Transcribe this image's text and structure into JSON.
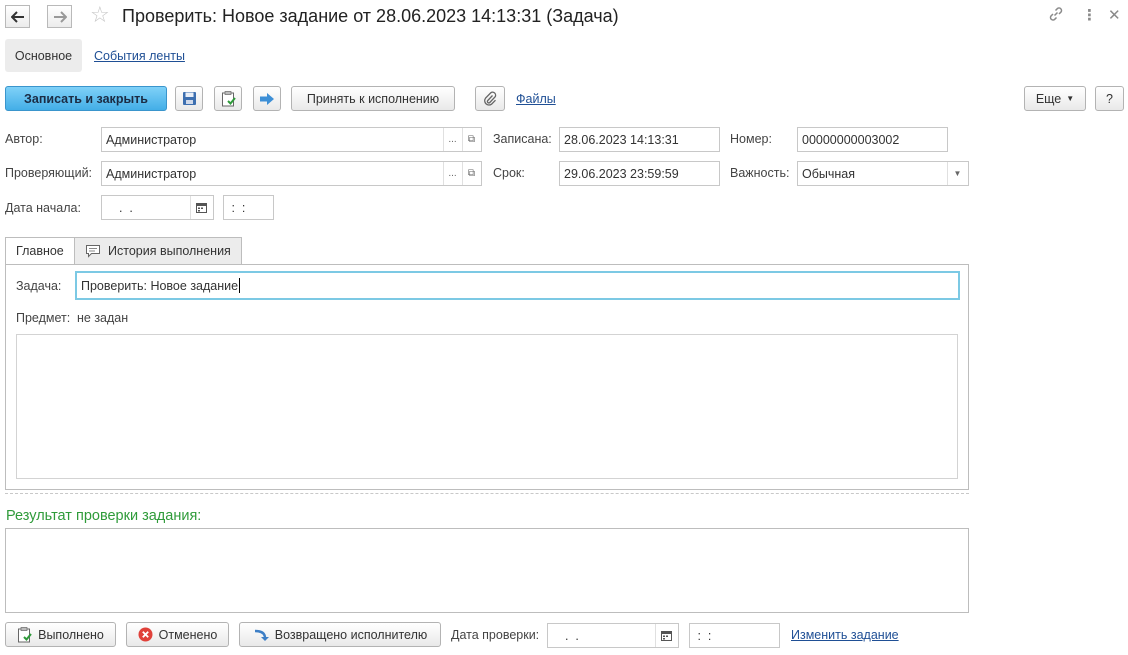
{
  "title_bar": {
    "title": "Проверить: Новое задание от 28.06.2023 14:13:31 (Задача)",
    "back_icon": "arrow-left",
    "forward_icon": "arrow-right",
    "favorite_icon": "star",
    "link_icon": "chain-link",
    "more_icon": "vertical-dots",
    "close_icon": "cross"
  },
  "form_tabs": {
    "main": "Основное",
    "feed": "События ленты"
  },
  "toolbar": {
    "save_close": "Записать и закрыть",
    "accept": "Принять к исполнению",
    "files": "Файлы",
    "more": "Еще",
    "help": "?"
  },
  "fields": {
    "author_label": "Автор:",
    "author_value": "Администратор",
    "recorded_label": "Записана:",
    "recorded_value": "28.06.2023 14:13:31",
    "number_label": "Номер:",
    "number_value": "00000000003002",
    "reviewer_label": "Проверяющий:",
    "reviewer_value": "Администратор",
    "deadline_label": "Срок:",
    "deadline_value": "29.06.2023 23:59:59",
    "importance_label": "Важность:",
    "importance_value": "Обычная",
    "start_date_label": "Дата начала:",
    "start_date_value": "  .  .",
    "start_time_value": " :  :"
  },
  "tabs": {
    "main": "Главное",
    "history": "История выполнения"
  },
  "task": {
    "task_label": "Задача:",
    "task_value": "Проверить: Новое задание",
    "subject_label": "Предмет:",
    "subject_value": "не задан",
    "description": ""
  },
  "result": {
    "heading": "Результат проверки задания:",
    "text": ""
  },
  "bottom_bar": {
    "done": "Выполнено",
    "cancelled": "Отменено",
    "returned": "Возвращено исполнителю",
    "check_date_label": "Дата проверки:",
    "check_date_value": "  .  .",
    "check_time_value": " :  :",
    "change_task": "Изменить задание"
  },
  "colors": {
    "primary_button": "#4fb6ec",
    "result_heading": "#2f9b3a",
    "link": "#1f4f95",
    "focus_border": "#7cc9e4"
  }
}
